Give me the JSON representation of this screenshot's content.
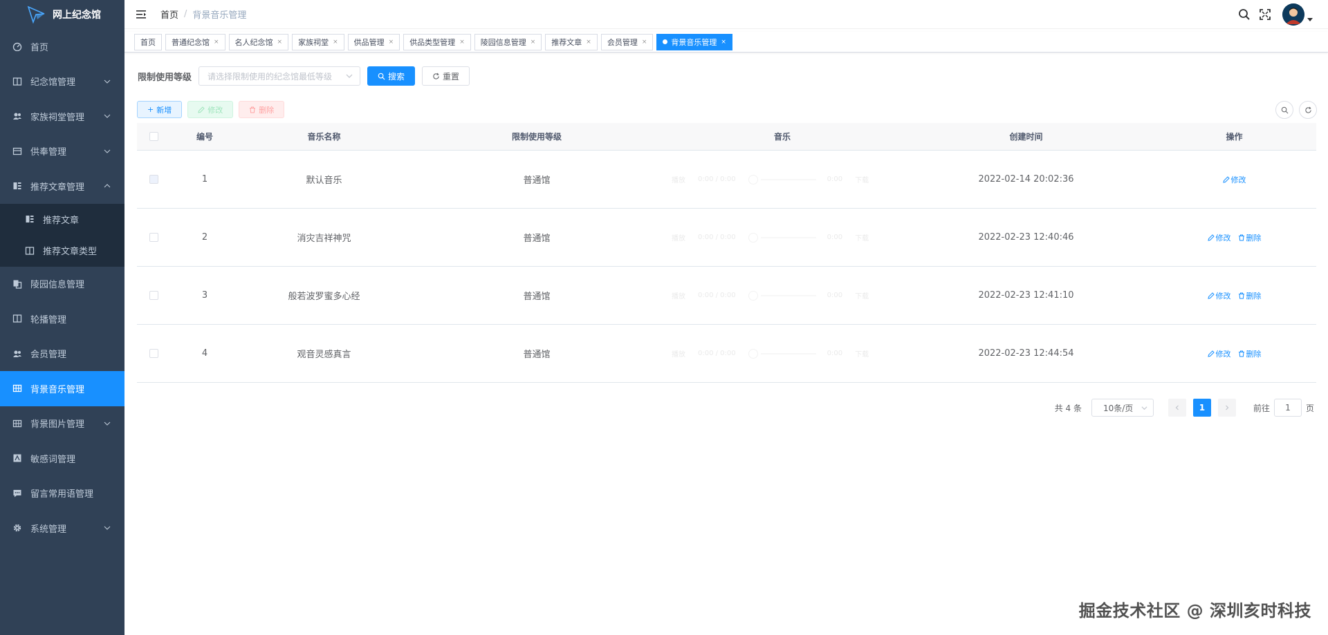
{
  "app": {
    "title": "网上纪念馆",
    "brand_color": "#1890ff",
    "sidebar_bg": "#304156"
  },
  "sidebar": {
    "items": [
      {
        "label": "首页",
        "icon": "dashboard-icon",
        "has_children": false
      },
      {
        "label": "纪念馆管理",
        "icon": "columns-icon",
        "has_children": true
      },
      {
        "label": "家族祠堂管理",
        "icon": "users-icon",
        "has_children": true
      },
      {
        "label": "供奉管理",
        "icon": "table-icon",
        "has_children": true
      },
      {
        "label": "推荐文章管理",
        "icon": "article-icon",
        "has_children": true,
        "expanded": true
      },
      {
        "label": "陵园信息管理",
        "icon": "copy-icon",
        "has_children": false
      },
      {
        "label": "轮播管理",
        "icon": "columns-icon",
        "has_children": false
      },
      {
        "label": "会员管理",
        "icon": "users-icon",
        "has_children": false
      },
      {
        "label": "背景音乐管理",
        "icon": "grid-icon",
        "has_children": false,
        "active": true
      },
      {
        "label": "背景图片管理",
        "icon": "grid-icon",
        "has_children": true
      },
      {
        "label": "敏感词管理",
        "icon": "text-icon",
        "has_children": false
      },
      {
        "label": "留言常用语管理",
        "icon": "message-icon",
        "has_children": false
      },
      {
        "label": "系统管理",
        "icon": "gear-icon",
        "has_children": true
      }
    ],
    "submenu": [
      {
        "label": "推荐文章",
        "icon": "article-icon"
      },
      {
        "label": "推荐文章类型",
        "icon": "columns-icon"
      }
    ]
  },
  "header": {
    "breadcrumb": {
      "home": "首页",
      "sep": "/",
      "current": "背景音乐管理"
    }
  },
  "tags": [
    {
      "label": "首页",
      "closable": false
    },
    {
      "label": "普通纪念馆",
      "closable": true
    },
    {
      "label": "名人纪念馆",
      "closable": true
    },
    {
      "label": "家族祠堂",
      "closable": true
    },
    {
      "label": "供品管理",
      "closable": true
    },
    {
      "label": "供品类型管理",
      "closable": true
    },
    {
      "label": "陵园信息管理",
      "closable": true
    },
    {
      "label": "推荐文章",
      "closable": true
    },
    {
      "label": "会员管理",
      "closable": true
    },
    {
      "label": "背景音乐管理",
      "closable": true,
      "active": true
    }
  ],
  "tag_close_glyph": "×",
  "search": {
    "label": "限制使用等级",
    "placeholder": "请选择限制使用的纪念馆最低等级",
    "search_btn": "搜索",
    "reset_btn": "重置"
  },
  "toolbar": {
    "add": "新增",
    "edit": "修改",
    "delete": "删除"
  },
  "table": {
    "headers": {
      "id": "编号",
      "name": "音乐名称",
      "level": "限制使用等级",
      "music": "音乐",
      "time": "创建时间",
      "ops": "操作"
    },
    "rows": [
      {
        "id": "1",
        "name": "默认音乐",
        "level": "普通馆",
        "time": "2022-02-14 20:02:36",
        "can_delete": false,
        "disabled": true
      },
      {
        "id": "2",
        "name": "消灾吉祥神咒",
        "level": "普通馆",
        "time": "2022-02-23 12:40:46",
        "can_delete": true,
        "disabled": false
      },
      {
        "id": "3",
        "name": "般若波罗蜜多心经",
        "level": "普通馆",
        "time": "2022-02-23 12:41:10",
        "can_delete": true,
        "disabled": false
      },
      {
        "id": "4",
        "name": "观音灵感真言",
        "level": "普通馆",
        "time": "2022-02-23 12:44:54",
        "can_delete": true,
        "disabled": false
      }
    ],
    "op_edit": "修改",
    "op_delete": "删除",
    "audio": {
      "play": "播放",
      "time": "0:00 / 0:00",
      "remain": "0:00",
      "download": "下载"
    }
  },
  "pagination": {
    "total": "共 4 条",
    "page_size": "10条/页",
    "current_page": "1",
    "goto_label": "前往",
    "goto_value": "1",
    "page_unit": "页"
  },
  "watermark": "掘金技术社区 @ 深圳亥时科技"
}
